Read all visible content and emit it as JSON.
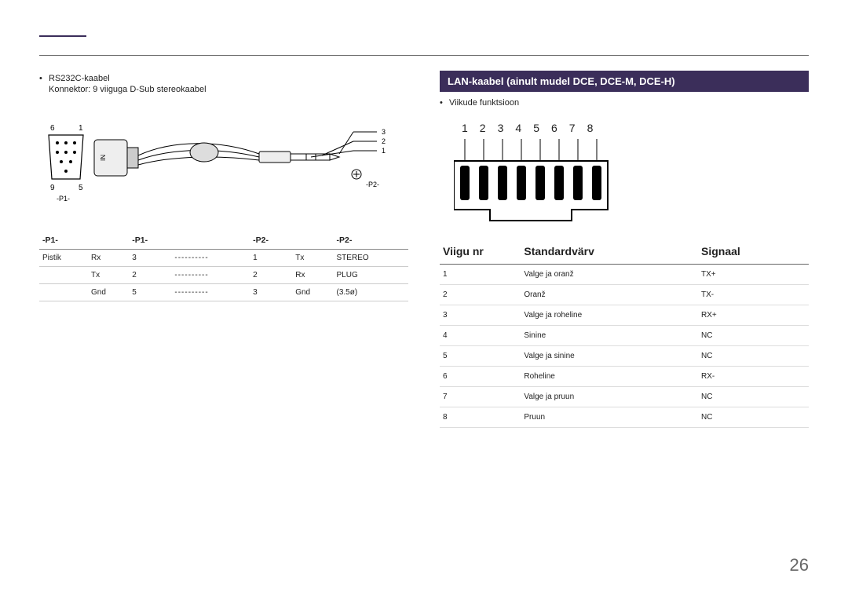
{
  "page_number": "26",
  "left": {
    "bullet1": "RS232C-kaabel",
    "sub1": "Konnektor: 9 viiguga D-Sub stereokaabel",
    "diagram": {
      "pins_left": [
        "6",
        "1",
        "9",
        "5"
      ],
      "p1_label": "-P1-",
      "plug_labels": [
        "3",
        "2",
        "1"
      ],
      "p2_label": "-P2-"
    },
    "table": {
      "head": [
        "-P1-",
        "",
        "-P1-",
        "",
        "-P2-",
        "",
        "-P2-"
      ],
      "rows": [
        [
          "Pistik",
          "Rx",
          "3",
          "----------",
          "1",
          "Tx",
          "STEREO"
        ],
        [
          "",
          "Tx",
          "2",
          "----------",
          "2",
          "Rx",
          "PLUG"
        ],
        [
          "",
          "Gnd",
          "5",
          "----------",
          "3",
          "Gnd",
          "(3.5ø)"
        ]
      ]
    }
  },
  "right": {
    "header": "LAN-kaabel (ainult mudel DCE, DCE-M, DCE-H)",
    "bullet1": "Viikude funktsioon",
    "pin_numbers": [
      "1",
      "2",
      "3",
      "4",
      "5",
      "6",
      "7",
      "8"
    ],
    "table": {
      "head": [
        "Viigu nr",
        "Standardvärv",
        "Signaal"
      ],
      "rows": [
        [
          "1",
          "Valge ja oranž",
          "TX+"
        ],
        [
          "2",
          "Oranž",
          "TX-"
        ],
        [
          "3",
          "Valge ja roheline",
          "RX+"
        ],
        [
          "4",
          "Sinine",
          "NC"
        ],
        [
          "5",
          "Valge ja sinine",
          "NC"
        ],
        [
          "6",
          "Roheline",
          "RX-"
        ],
        [
          "7",
          "Valge ja pruun",
          "NC"
        ],
        [
          "8",
          "Pruun",
          "NC"
        ]
      ]
    }
  }
}
